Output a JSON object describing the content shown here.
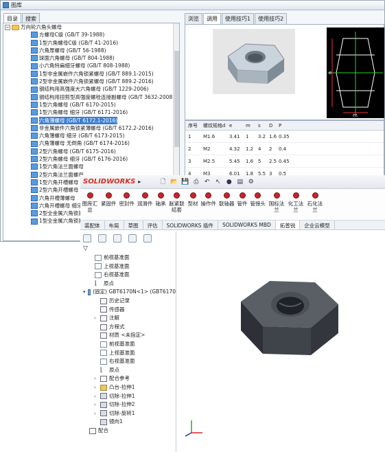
{
  "library": {
    "title": "图库",
    "tabs": [
      "目录",
      "搜索"
    ],
    "root": "万向轮六角头螺母",
    "items": [
      "方螺母C级 (GB/T 39-1988)",
      "1型六角螺母C级 (GB/T 41-2016)",
      "六角厚螺母 (GB/T 56-1988)",
      "球面六角螺母 (GB/T 804-1988)",
      "小六角特扁细牙螺母 (GB/T 808-1988)",
      "1型非金属嵌件六角锁紧螺母 (GB/T 889.1-2015)",
      "2型非金属嵌件六角锁紧螺母 (GB/T 889.2-2016)",
      "钢结构用高强度大六角螺母 (GB/T 1229-2006)",
      "钢结构用扭剪型高强度螺栓连接副螺母 (GB/T 3632-2008)",
      "1型六角螺母 (GB/T 6170-2015)",
      "1型六角螺母 细牙 (GB/T 6171-2016)",
      "六角薄螺母 (GB/T 6172.1-2016)",
      "非金属嵌件六角锁紧薄螺母 (GB/T 6172.2-2016)",
      "六角薄螺母 细牙 (GB/T 6173-2015)",
      "六角薄螺母 无倒角 (GB/T 6174-2016)",
      "2型六角螺母 (GB/T 6175-2016)",
      "2型六角螺母 细牙 (GB/T 6176-2016)",
      "1型六角法兰面螺母",
      "2型六角法兰面螺母",
      "1型六角开槽螺母",
      "2型六角开槽螺母",
      "六角开槽薄螺母",
      "六角开槽螺母 细牙",
      "2型全金属六角锁紧螺母",
      "1型全金属六角锁紧螺母"
    ],
    "selected_index": 11
  },
  "rightpane": {
    "tabs": [
      "浏览",
      "调用",
      "使用技巧1",
      "使用技巧2"
    ],
    "active_tab": 1,
    "table": {
      "headers": [
        "序号",
        "螺纹规格d",
        "e",
        "m",
        "s",
        "D",
        "P"
      ],
      "rows": [
        [
          "1",
          "M1.6",
          "3.41",
          "1",
          "3.2",
          "1.6",
          "0.35"
        ],
        [
          "2",
          "M2",
          "4.32",
          "1.2",
          "4",
          "2",
          "0.4"
        ],
        [
          "3",
          "M2.5",
          "5.45",
          "1.6",
          "5",
          "2.5",
          "0.45"
        ],
        [
          "4",
          "M3",
          "6.01",
          "1.8",
          "5.5",
          "3",
          "0.5"
        ]
      ]
    },
    "drawing_labels": [
      "e",
      "m"
    ]
  },
  "solidworks": {
    "logo": "SOLIDWORKS",
    "ribbon": [
      "图库汇总",
      "紧固件",
      "密封件",
      "润滑件",
      "轴承",
      "胀紧联结套",
      "型材",
      "操作件",
      "联轴器",
      "管件",
      "管接头",
      "国标法兰",
      "化工法兰",
      "石化法兰"
    ],
    "cm_tabs": [
      "装配体",
      "布局",
      "草图",
      "评估",
      "SOLIDWORKS 插件",
      "SOLIDWORKS MBD",
      "拓普锐",
      "企业云模型"
    ],
    "active_cm_tab": 6,
    "feature_tree": [
      {
        "label": "前视基准面",
        "icon": "plane",
        "level": 1
      },
      {
        "label": "上视基准面",
        "icon": "plane",
        "level": 1
      },
      {
        "label": "右视基准面",
        "icon": "plane",
        "level": 1
      },
      {
        "label": "原点",
        "icon": "origin",
        "level": 1
      },
      {
        "label": "(固定) GBT6170N<1> (GBT6170",
        "icon": "part",
        "level": 0,
        "arrow": "▾"
      },
      {
        "label": "历史记录",
        "icon": "plain",
        "level": 2
      },
      {
        "label": "传感器",
        "icon": "plain",
        "level": 2
      },
      {
        "label": "注解",
        "icon": "plain",
        "level": 2,
        "arrow": "›"
      },
      {
        "label": "方程式",
        "icon": "plain",
        "level": 2
      },
      {
        "label": "材质 <未指定>",
        "icon": "plain",
        "level": 2
      },
      {
        "label": "前视基准面",
        "icon": "plane",
        "level": 2
      },
      {
        "label": "上视基准面",
        "icon": "plane",
        "level": 2
      },
      {
        "label": "右视基准面",
        "icon": "plane",
        "level": 2
      },
      {
        "label": "原点",
        "icon": "origin",
        "level": 2
      },
      {
        "label": "配合参考",
        "icon": "plain",
        "level": 2,
        "arrow": "›"
      },
      {
        "label": "凸台-拉伸1",
        "icon": "feat",
        "level": 2,
        "arrow": "›"
      },
      {
        "label": "切除-拉伸1",
        "icon": "cut",
        "level": 2,
        "arrow": "›"
      },
      {
        "label": "切除-拉伸2",
        "icon": "cut",
        "level": 2,
        "arrow": "›"
      },
      {
        "label": "切除-旋转1",
        "icon": "cut",
        "level": 2,
        "arrow": "›"
      },
      {
        "label": "镜向1",
        "icon": "cut",
        "level": 2
      },
      {
        "label": "配合",
        "icon": "plain",
        "level": 0
      }
    ]
  }
}
